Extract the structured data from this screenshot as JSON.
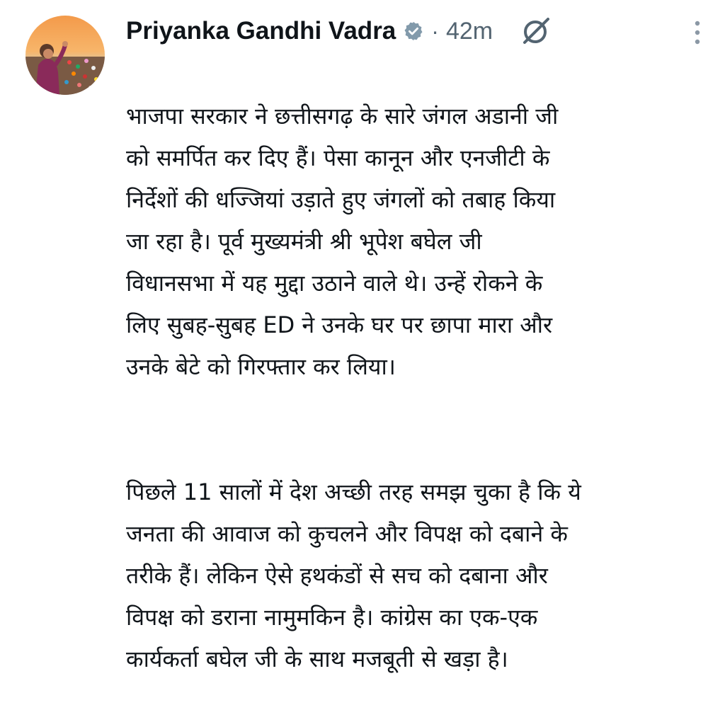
{
  "post": {
    "author_name": "Priyanka Gandhi Vadra",
    "separator": "·",
    "time_ago": "42m",
    "icons": {
      "verified": "verified-badge-icon",
      "grok": "grok-icon",
      "more": "more-options-icon"
    },
    "colors": {
      "verified_badge": "#829aab",
      "secondary_text": "#536471",
      "primary_text": "#0f1419"
    },
    "paragraphs": [
      "भाजपा सरकार ने छत्तीसगढ़ के सारे जंगल अडानी जी\nको समर्पित कर दिए हैं। पेसा कानून और एनजीटी के\nनिर्देशों की धज्जियां उड़ाते हुए जंगलों को तबाह किया\nजा रहा है। पूर्व मुख्यमंत्री श्री भूपेश बघेल जी\nविधानसभा में यह मुद्दा उठाने वाले थे। उन्हें रोकने के\nलिए सुबह-सुबह ED ने उनके घर पर छापा मारा और\nउनके बेटे को गिरफ्तार कर लिया।",
      "पिछले 11 सालों में देश अच्छी तरह समझ चुका है कि ये\nजनता की आवाज को कुचलने और विपक्ष को दबाने के\nतरीके हैं। लेकिन ऐसे हथकंडों से सच को दबाना और\nविपक्ष को डराना नामुमकिन है। कांग्रेस का एक-एक\nकार्यकर्ता बघेल जी के साथ मजबूती से खड़ा है।"
    ]
  }
}
